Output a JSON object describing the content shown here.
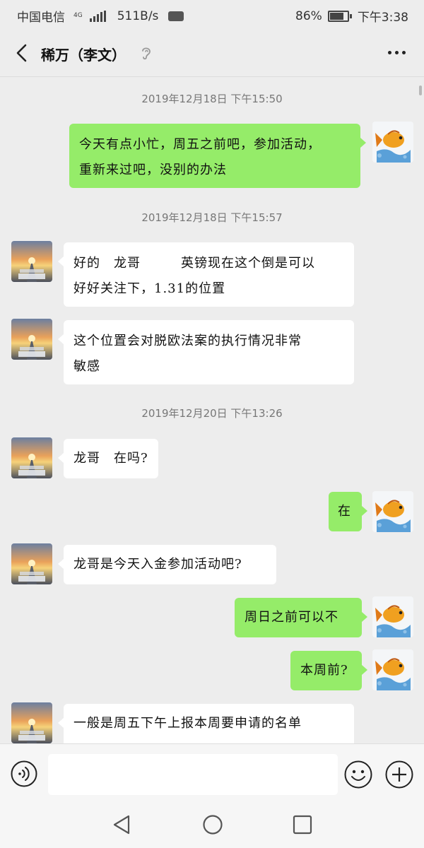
{
  "status_bar": {
    "carrier": "中国电信",
    "network_tag": "4G",
    "speed": "511B/s",
    "battery": "86%",
    "battery_level": 0.86,
    "time": "下午3:38"
  },
  "header": {
    "title": "稀万（李文）",
    "back_icon": "chevron-left-icon",
    "more_icon": "more-dots-icon",
    "ear_icon": "ear-icon"
  },
  "messages": [
    {
      "type": "timestamp",
      "text": "2019年12月18日 下午15:50"
    },
    {
      "type": "out",
      "lines": [
        "今天有点小忙，周五之前吧，参加活动，",
        "重新来过吧，没别的办法"
      ]
    },
    {
      "type": "timestamp",
      "text": "2019年12月18日 下午15:57"
    },
    {
      "type": "in",
      "lines": [
        "好的　龙哥　　　英镑现在这个倒是可以",
        "好好关注下，1.31的位置"
      ]
    },
    {
      "type": "in",
      "lines": [
        "这个位置会对脱欧法案的执行情况非常",
        "敏感"
      ]
    },
    {
      "type": "timestamp",
      "text": "2019年12月20日 下午13:26"
    },
    {
      "type": "in",
      "lines": [
        "龙哥　在吗?"
      ]
    },
    {
      "type": "out",
      "lines": [
        "在"
      ]
    },
    {
      "type": "in",
      "lines": [
        "龙哥是今天入金参加活动吧?"
      ]
    },
    {
      "type": "out",
      "lines": [
        "周日之前可以不"
      ]
    },
    {
      "type": "out",
      "lines": [
        "本周前?"
      ]
    },
    {
      "type": "in",
      "lines": [
        "一般是周五下午上报本周要申请的名单"
      ]
    }
  ],
  "avatars": {
    "contact": "sunset-road-2020-avatar",
    "self": "koi-fish-avatar"
  },
  "input": {
    "placeholder": "",
    "voice_icon": "voice-icon",
    "emoji_icon": "emoji-icon",
    "plus_icon": "plus-icon"
  },
  "nav": {
    "back_icon": "nav-back-icon",
    "home_icon": "nav-home-icon",
    "recent_icon": "nav-recent-icon"
  },
  "colors": {
    "background": "#ededed",
    "outgoing_bubble": "#95ec69",
    "incoming_bubble": "#ffffff"
  }
}
